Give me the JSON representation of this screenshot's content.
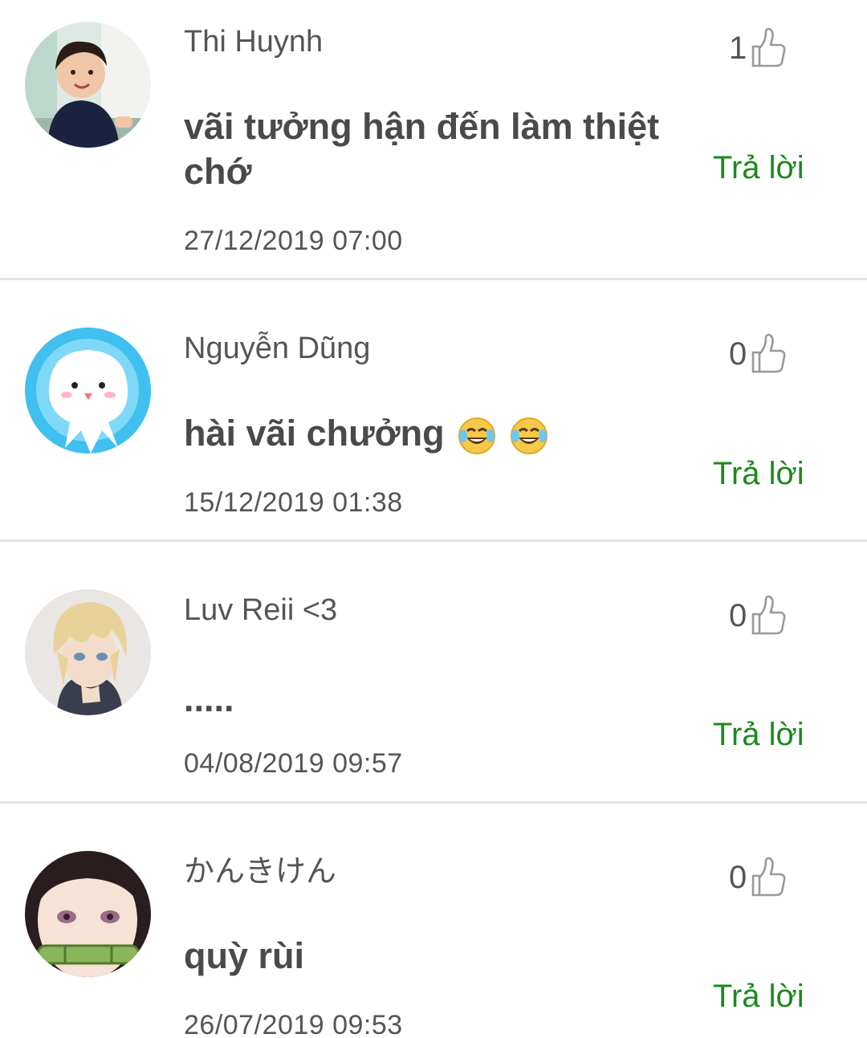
{
  "comments": [
    {
      "author": "Thi Huynh",
      "text": "vãi tưởng hận đến làm thiệt chớ",
      "timestamp": "27/12/2019 07:00",
      "likes": "1",
      "reply_label": "Trả lời",
      "avatar": "toddler-photo"
    },
    {
      "author": "Nguyễn Dũng",
      "text": "hài vãi chưởng",
      "emoji": [
        "face-with-tears-of-joy-icon",
        "face-with-tears-of-joy-icon"
      ],
      "timestamp": "15/12/2019 01:38",
      "likes": "0",
      "reply_label": "Trả lời",
      "avatar": "octopus-cartoon"
    },
    {
      "author": "Luv Reii <3",
      "text": ".....",
      "timestamp": "04/08/2019 09:57",
      "likes": "0",
      "reply_label": "Trả lời",
      "avatar": "anime-boy"
    },
    {
      "author": "かんきけん",
      "text": "quỳ rùi",
      "timestamp": "26/07/2019 09:53",
      "likes": "0",
      "reply_label": "Trả lời",
      "avatar": "anime-girl-bamboo"
    }
  ],
  "colors": {
    "reply": "#1a8a1a",
    "text": "#4a4a4a",
    "meta": "#555555",
    "divider": "#e2e2e2"
  }
}
